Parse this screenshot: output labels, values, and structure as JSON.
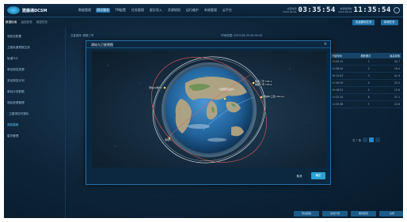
{
  "header": {
    "app_title": "雅藤通DCSM",
    "nav": [
      "数据管理",
      "测试服务",
      "TM配置",
      "任务管理",
      "星历导入",
      "资源规划",
      "运行维护",
      "系统管理",
      "云平台"
    ],
    "nav_active_index": 1,
    "clock1_label_top": "北京时间",
    "clock1_label_bottom": "2023-06-30",
    "clock1_time": "03:35:54",
    "clock2_label_top": "协调世界时",
    "clock2_label_bottom": "2023-06-29",
    "clock2_time": "11:35:54"
  },
  "tabrow": {
    "tabs": [
      "数据检索",
      "运控任务",
      "测控任务"
    ],
    "active_index": 0,
    "right_buttons": [
      "批量删除任务",
      "新增任务"
    ]
  },
  "sidebar": {
    "items": [
      "测控站配置",
      "卫星轨道预报生成",
      "轨道TLE",
      "单站测控资源",
      "多站测控计划",
      "单站计划数据",
      "测站资源管理",
      "· 卫星测控可视化",
      "测控弧段",
      "星历管理"
    ],
    "active_index": 7
  },
  "filterbar": {
    "label1": "卫星选择:",
    "value1": "雅藤三号",
    "label2": "时间范围:",
    "value2": "2023-06-30 00:00:00",
    "label3": "测站",
    "value3": "全部"
  },
  "table": {
    "headers": [
      "开始时间",
      "跟踪圈次",
      "最高仰角"
    ],
    "rows": [
      [
        "03:05:12",
        "1",
        "32.7"
      ],
      [
        "04:38:40",
        "2",
        "18.4"
      ],
      [
        "06:12:03",
        "3",
        "41.9"
      ],
      [
        "07:45:29",
        "4",
        "25.3"
      ],
      [
        "09:18:51",
        "5",
        "12.6"
      ],
      [
        "10:52:14",
        "6",
        "37.1"
      ],
      [
        "12:25:38",
        "7",
        "22.8"
      ]
    ]
  },
  "pager": {
    "total": "共 7 条",
    "current": "1"
  },
  "bottom_buttons": [
    "导出弧段",
    "生成计划",
    "保存配置",
    "关闭"
  ],
  "modal": {
    "title": "测站与卫星视图",
    "close": "×",
    "cancel_label": "取消",
    "ok_label": "确定",
    "labels": [
      "测站A(喀什)",
      "雅藤三号 TLE-1",
      "雅藤一号 TLE-2",
      "测站B(三亚)-Sanya",
      "测站C"
    ]
  },
  "colors": {
    "accent": "#2aa3d4",
    "orbit_red": "#e35a5a",
    "orbit_white": "#f3f7fb",
    "ocean": "#2b76b5",
    "land": "#b8a780"
  }
}
